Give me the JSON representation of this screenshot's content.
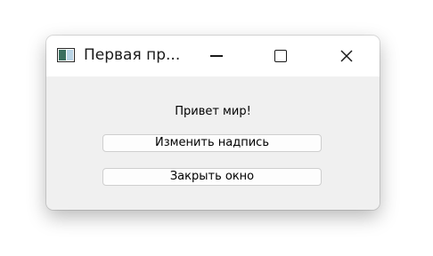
{
  "window": {
    "title": "Первая пр...",
    "icon": "app-window-icon"
  },
  "titlebar_controls": {
    "minimize_icon": "minimize-icon",
    "maximize_icon": "maximize-icon",
    "close_icon": "close-icon"
  },
  "main": {
    "label": "Привет мир!",
    "change_button_label": "Изменить надпись",
    "close_button_label": "Закрыть окно"
  }
}
